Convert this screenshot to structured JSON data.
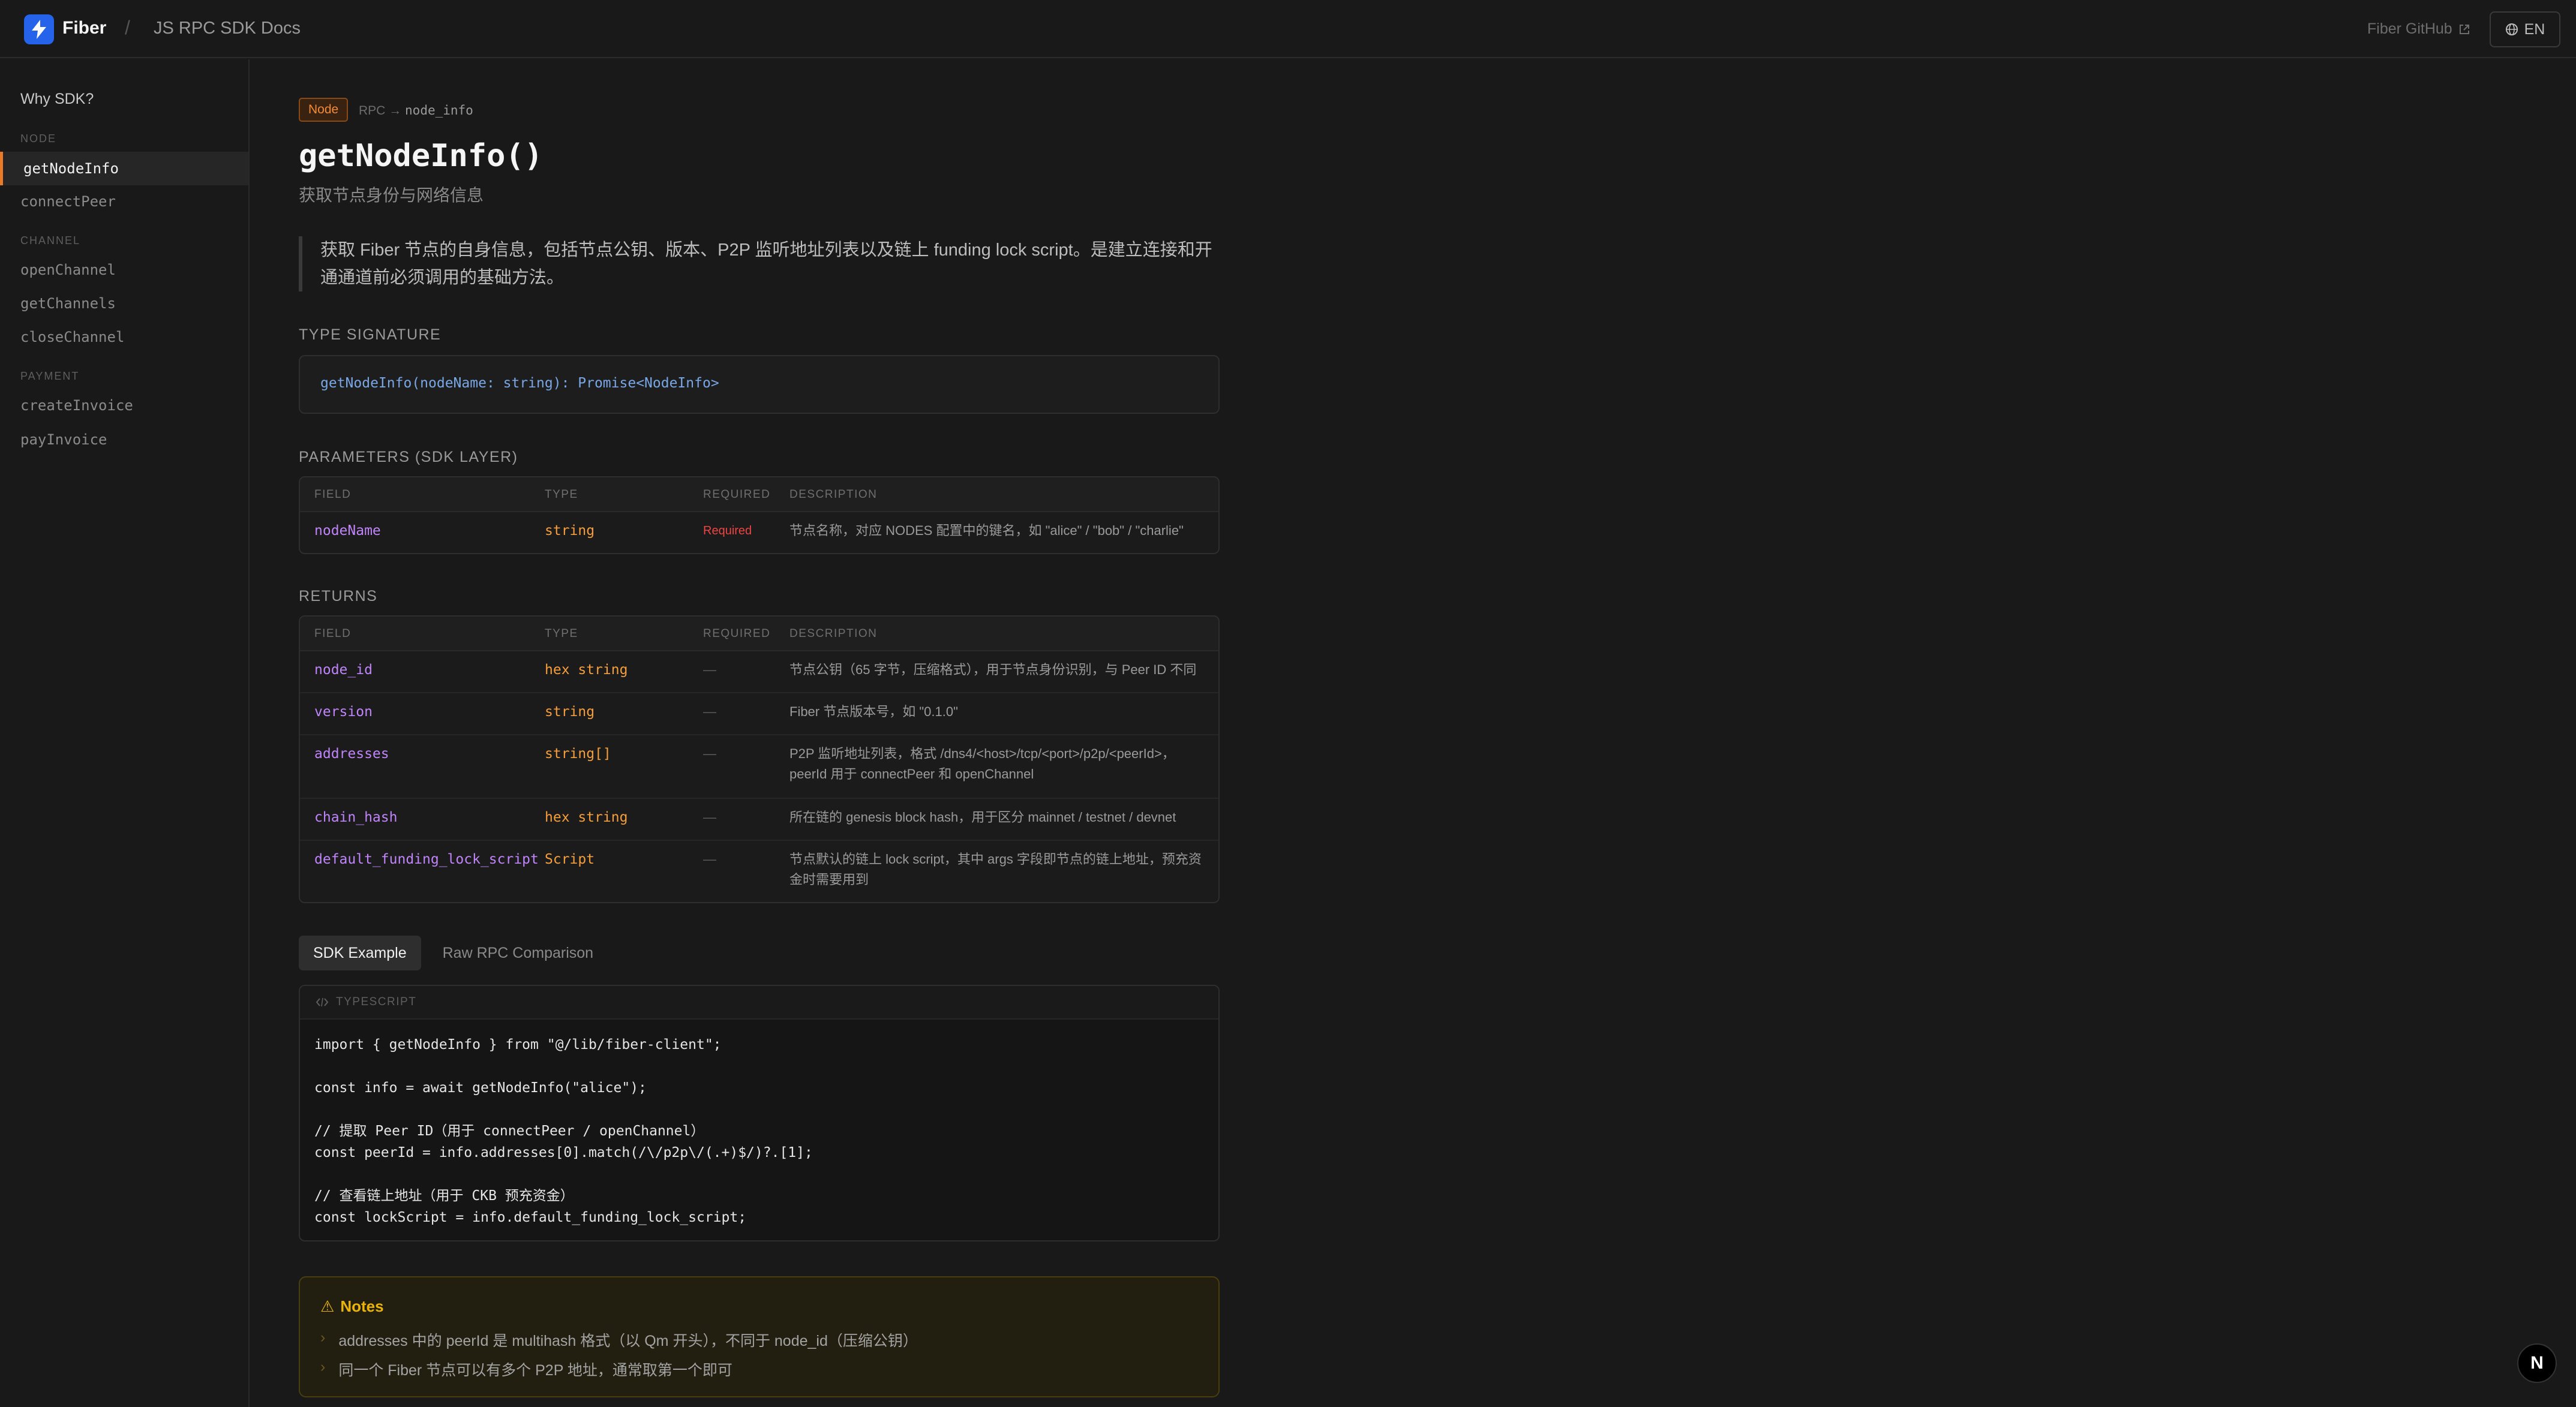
{
  "header": {
    "brand": "Fiber",
    "separator": "/",
    "title": "JS RPC SDK Docs",
    "github_label": "Fiber GitHub",
    "lang_label": "EN"
  },
  "sidebar": {
    "top_item": "Why SDK?",
    "sections": [
      {
        "label": "NODE",
        "items": [
          "getNodeInfo",
          "connectPeer"
        ]
      },
      {
        "label": "CHANNEL",
        "items": [
          "openChannel",
          "getChannels",
          "closeChannel"
        ]
      },
      {
        "label": "PAYMENT",
        "items": [
          "createInvoice",
          "payInvoice"
        ]
      }
    ],
    "active_item": "getNodeInfo"
  },
  "page": {
    "badge": "Node",
    "crumb_prefix": "RPC →",
    "crumb_method": "node_info",
    "title": "getNodeInfo()",
    "subtitle": "获取节点身份与网络信息",
    "description": "获取 Fiber 节点的自身信息，包括节点公钥、版本、P2P 监听地址列表以及链上 funding lock script。是建立连接和开通通道前必须调用的基础方法。"
  },
  "signature": {
    "label": "TYPE SIGNATURE",
    "code": "getNodeInfo(nodeName: string): Promise<NodeInfo>"
  },
  "params": {
    "label": "PARAMETERS (SDK LAYER)",
    "columns": [
      "FIELD",
      "TYPE",
      "REQUIRED",
      "DESCRIPTION"
    ],
    "rows": [
      {
        "field": "nodeName",
        "type": "string",
        "required": "Required",
        "desc": "节点名称，对应 NODES 配置中的键名，如 \"alice\" / \"bob\" / \"charlie\""
      }
    ]
  },
  "returns": {
    "label": "RETURNS",
    "columns": [
      "FIELD",
      "TYPE",
      "REQUIRED",
      "DESCRIPTION"
    ],
    "rows": [
      {
        "field": "node_id",
        "type": "hex string",
        "required": "—",
        "desc": "节点公钥（65 字节，压缩格式），用于节点身份识别，与 Peer ID 不同"
      },
      {
        "field": "version",
        "type": "string",
        "required": "—",
        "desc": "Fiber 节点版本号，如 \"0.1.0\""
      },
      {
        "field": "addresses",
        "type": "string[]",
        "required": "—",
        "desc": "P2P 监听地址列表，格式 /dns4/<host>/tcp/<port>/p2p/<peerId>，peerId 用于 connectPeer 和 openChannel"
      },
      {
        "field": "chain_hash",
        "type": "hex string",
        "required": "—",
        "desc": "所在链的 genesis block hash，用于区分 mainnet / testnet / devnet"
      },
      {
        "field": "default_funding_lock_script",
        "type": "Script",
        "required": "—",
        "desc": "节点默认的链上 lock script，其中 args 字段即节点的链上地址，预充资金时需要用到"
      }
    ]
  },
  "tabs": {
    "items": [
      "SDK Example",
      "Raw RPC Comparison"
    ],
    "active": "SDK Example"
  },
  "code": {
    "language": "TYPESCRIPT",
    "lines": "import { getNodeInfo } from \"@/lib/fiber-client\";\n\nconst info = await getNodeInfo(\"alice\");\n\n// 提取 Peer ID（用于 connectPeer / openChannel）\nconst peerId = info.addresses[0].match(/\\/p2p\\/(.+)$/)?.[1];\n\n// 查看链上地址（用于 CKB 预充资金）\nconst lockScript = info.default_funding_lock_script;"
  },
  "notes": {
    "title": "Notes",
    "items": [
      "addresses 中的 peerId 是 multihash 格式（以 Qm 开头），不同于 node_id（压缩公钥）",
      "同一个 Fiber 节点可以有多个 P2P 地址，通常取第一个即可"
    ]
  },
  "fab": {
    "label": "N"
  },
  "colors": {
    "accent": "#ea7a27",
    "brand_blue": "#2563eb",
    "field_purple": "#c084fc",
    "type_orange": "#f59e3b",
    "required_red": "#ef4444",
    "notes_yellow": "#eab308"
  }
}
